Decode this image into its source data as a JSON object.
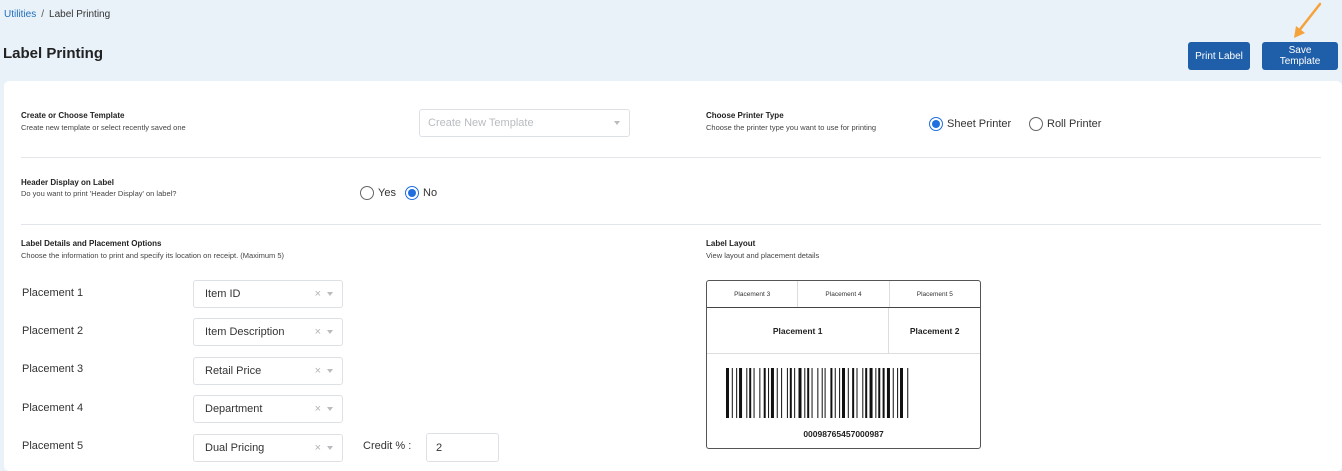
{
  "breadcrumb": {
    "parent": "Utilities",
    "separator": "/",
    "current": "Label Printing"
  },
  "page": {
    "title": "Label Printing"
  },
  "buttons": {
    "print_label": "Print Label",
    "save_template": "Save Template"
  },
  "template": {
    "title": "Create or Choose Template",
    "subtitle": "Create new template or select recently saved one",
    "placeholder": "Create New Template"
  },
  "printer": {
    "title": "Choose Printer Type",
    "subtitle": "Choose the printer type you want to use for printing",
    "options": [
      {
        "label": "Sheet Printer",
        "selected": true
      },
      {
        "label": "Roll Printer",
        "selected": false
      }
    ]
  },
  "header_display": {
    "title": "Header Display on Label",
    "subtitle": "Do you want to print 'Header Display' on label?",
    "options": [
      {
        "label": "Yes",
        "selected": false
      },
      {
        "label": "No",
        "selected": true
      }
    ]
  },
  "details": {
    "title": "Label Details and Placement Options",
    "subtitle": "Choose the information to print and specify its location on receipt.  (Maximum 5)",
    "placements": [
      {
        "label": "Placement 1",
        "value": "Item ID"
      },
      {
        "label": "Placement 2",
        "value": "Item Description"
      },
      {
        "label": "Placement 3",
        "value": "Retail Price"
      },
      {
        "label": "Placement 4",
        "value": "Department"
      },
      {
        "label": "Placement 5",
        "value": "Dual Pricing"
      }
    ],
    "credit_label": "Credit % :",
    "credit_value": "2",
    "clear_glyph": "×"
  },
  "layout": {
    "title": "Label Layout",
    "subtitle": "View layout and placement details",
    "top_row": [
      "Placement 3",
      "Placement 4",
      "Placement 5"
    ],
    "middle_row": [
      "Placement 1",
      "Placement 2"
    ],
    "barcode_number": "00098765457000987"
  },
  "colors": {
    "primary": "#1f5fa9",
    "radio_selected": "#1f6fdf",
    "background": "#e9f1f9",
    "arrow": "#f5a23a"
  }
}
